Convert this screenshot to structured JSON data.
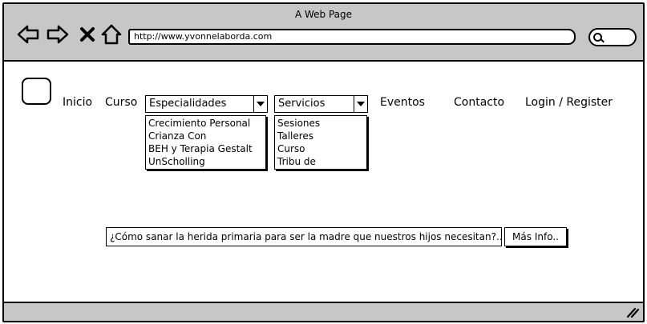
{
  "window": {
    "title": "A Web Page"
  },
  "browser": {
    "url": "http://www.yvonnelaborda.com",
    "icons": [
      "back-arrow-icon",
      "forward-arrow-icon",
      "close-x-icon",
      "home-icon",
      "search-icon",
      "resize-grip-icon"
    ]
  },
  "nav": {
    "inicio": "Inicio",
    "curso": "Curso",
    "especialidades": {
      "selected": "Especialidades",
      "options": [
        "Crecimiento Personal",
        "Crianza Con",
        "BEH y Terapia Gestalt",
        "UnScholling"
      ]
    },
    "servicios": {
      "selected": "Servicios",
      "options": [
        "Sesiones",
        "Talleres",
        "Curso",
        "Tribu de"
      ]
    },
    "eventos": "Eventos",
    "contacto": "Contacto",
    "login": "Login / Register"
  },
  "main": {
    "headline": "¿Cómo sanar la herida primaria para ser la madre que nuestros hijos necesitan?..",
    "more_button": "Más Info.."
  }
}
